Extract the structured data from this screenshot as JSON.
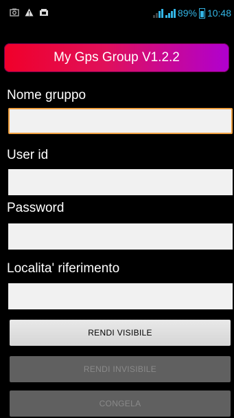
{
  "status_bar": {
    "left_icons": [
      "screenshot-icon",
      "warning-icon",
      "gallery-icon"
    ],
    "signal_label": "36",
    "battery": "89%",
    "time": "10:48",
    "accent": "#33b5e5"
  },
  "app": {
    "title": "My Gps Group V1.2.2"
  },
  "form": {
    "group_label": "Nome gruppo",
    "group_value": "",
    "user_label": "User id",
    "user_value": "",
    "password_label": "Password",
    "password_value": "",
    "locality_label": "Localita' riferimento",
    "locality_value": ""
  },
  "buttons": {
    "visible_label": "RENDI VISIBILE",
    "invisible_label": "RENDI INVISIBILE",
    "freeze_label": "CONGELA"
  }
}
